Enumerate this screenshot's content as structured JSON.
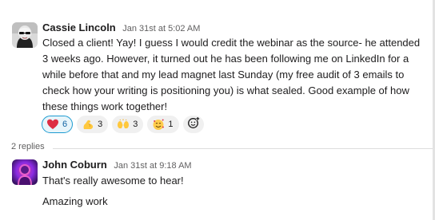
{
  "thread": {
    "parent": {
      "author": "Cassie Lincoln",
      "timestamp": "Jan 31st at 5:02 AM",
      "body_lines": [
        "Closed a client! Yay! I guess I would credit the webinar as the source- he attended",
        "3 weeks ago. However, it turned out he has been following me on LinkedIn for a",
        "while before that and my lead magnet last Sunday (my free audit of 3 emails to",
        "check how  your writing is positioning you) is what sealed. Good example of how",
        "these things work together!"
      ],
      "reactions": [
        {
          "emoji": "heart",
          "count": "6",
          "active": true
        },
        {
          "emoji": "flexed-biceps",
          "count": "3",
          "active": false
        },
        {
          "emoji": "raising-hands",
          "count": "3",
          "active": false
        },
        {
          "emoji": "smiling-face-with-hearts",
          "count": "1",
          "active": false
        }
      ],
      "add_reaction_icon": "add-reaction-icon"
    },
    "replies_label": "2 replies",
    "reply": {
      "author": "John Coburn",
      "timestamp": "Jan 31st at 9:18 AM",
      "line1": "That's really awesome to hear!",
      "line2": "Amazing work"
    }
  },
  "colors": {
    "accent_blue": "#1d9bd1",
    "reaction_bg": "#f0f0f0",
    "text_primary": "#1d1c1d",
    "text_muted": "#616061"
  }
}
